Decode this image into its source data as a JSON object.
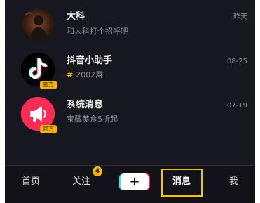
{
  "messages": [
    {
      "name": "大科",
      "subtitle": "和大科打个招呼吧",
      "time": "昨天",
      "avatar": "person-photo-avatar",
      "tag": ""
    },
    {
      "name": "抖音小助手",
      "subtitle_hash": "#",
      "subtitle": "2002舞",
      "time": "08-25",
      "avatar": "tiktok-logo-avatar",
      "tag": "官方"
    },
    {
      "name": "系统消息",
      "subtitle": "宝藏美食5折起",
      "time": "07-19",
      "avatar": "megaphone-avatar",
      "tag": "官方"
    }
  ],
  "tabbar": {
    "home": "首页",
    "following": "关注",
    "following_badge": "4",
    "add": "+",
    "messages": "消息",
    "me": "我"
  },
  "colors": {
    "background": "#17171f",
    "accent": "#f5b400",
    "brand_cyan": "#25f4ee",
    "brand_red": "#fe2c55"
  }
}
